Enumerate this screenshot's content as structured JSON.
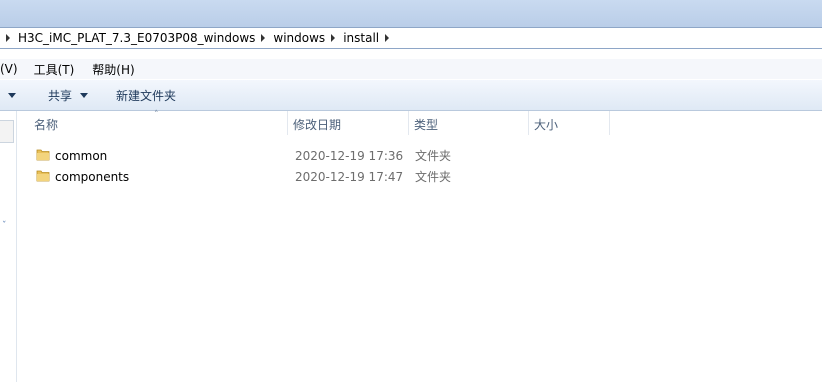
{
  "address": {
    "crumbs": [
      "H3C_iMC_PLAT_7.3_E0703P08_windows",
      "windows",
      "install"
    ]
  },
  "menu": {
    "items": [
      "(V)",
      "工具(T)",
      "帮助(H)"
    ]
  },
  "toolbar": {
    "share_label": "共享",
    "new_folder_label": "新建文件夹"
  },
  "columns": {
    "name": "名称",
    "date": "修改日期",
    "type": "类型",
    "size": "大小"
  },
  "files": [
    {
      "name": "common",
      "date": "2020-12-19  17:36",
      "type": "文件夹"
    },
    {
      "name": "components",
      "date": "2020-12-19  17:47",
      "type": "文件夹"
    }
  ],
  "colors": {
    "folder": "#e8c05a",
    "accent": "#1e395b"
  }
}
